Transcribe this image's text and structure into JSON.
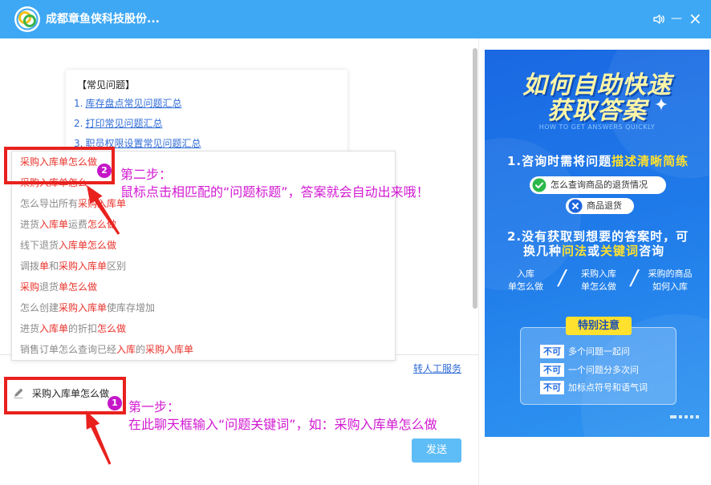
{
  "window": {
    "title": "成都章鱼侠科技股份...",
    "controls": {
      "minimize": "—",
      "close": "×"
    }
  },
  "icons": {
    "logo": "app-logo",
    "sound": "speaker-icon",
    "edit": "pencil-icon",
    "good_example": "check-circle-icon",
    "bad_example": "x-circle-icon",
    "title_decoration": "sparkle-icon"
  },
  "faq": {
    "heading": "【常见问题】",
    "items": [
      {
        "num": "1.",
        "text": "库存盘点常见问题汇总"
      },
      {
        "num": "2.",
        "text": "打印常见问题汇总"
      },
      {
        "num": "3.",
        "text": "职员权限设置常见问题汇总"
      }
    ]
  },
  "suggestions": [
    {
      "segments": [
        {
          "t": "采购入库单怎么做",
          "hl": true
        }
      ]
    },
    {
      "segments": [
        {
          "t": "采购入库单怎么",
          "hl": true
        }
      ]
    },
    {
      "segments": [
        {
          "t": "怎么导出所有",
          "hl": false
        },
        {
          "t": "采购入库单",
          "hl": true
        }
      ]
    },
    {
      "segments": [
        {
          "t": "进货",
          "hl": false
        },
        {
          "t": "入库单",
          "hl": true
        },
        {
          "t": "运费",
          "hl": false
        },
        {
          "t": "怎么做",
          "hl": true
        }
      ]
    },
    {
      "segments": [
        {
          "t": "线下退货",
          "hl": false
        },
        {
          "t": "入库单怎么做",
          "hl": true
        }
      ]
    },
    {
      "segments": [
        {
          "t": "调拨",
          "hl": false
        },
        {
          "t": "单",
          "hl": true
        },
        {
          "t": "和",
          "hl": false
        },
        {
          "t": "采购入库单",
          "hl": true
        },
        {
          "t": "区别",
          "hl": false
        }
      ]
    },
    {
      "segments": [
        {
          "t": "采购",
          "hl": true
        },
        {
          "t": "退货",
          "hl": false
        },
        {
          "t": "单怎么做",
          "hl": true
        }
      ]
    },
    {
      "segments": [
        {
          "t": "怎么创建",
          "hl": false
        },
        {
          "t": "采购入库单",
          "hl": true
        },
        {
          "t": "使库存增加",
          "hl": false
        }
      ]
    },
    {
      "segments": [
        {
          "t": "进货",
          "hl": false
        },
        {
          "t": "入库单",
          "hl": true
        },
        {
          "t": "的折扣",
          "hl": false
        },
        {
          "t": "怎么做",
          "hl": true
        }
      ]
    },
    {
      "segments": [
        {
          "t": "销售订单怎么查询已经",
          "hl": false
        },
        {
          "t": "入库",
          "hl": true
        },
        {
          "t": "的",
          "hl": false
        },
        {
          "t": "采购入库单",
          "hl": true
        }
      ]
    }
  ],
  "annotations": {
    "step2": {
      "badge": "2",
      "title": "第二步：",
      "text": "鼠标点击相匹配的“问题标题”，答案就会自动出来哦！"
    },
    "step1": {
      "badge": "1",
      "title": "第一步：",
      "text": "在此聊天框输入“问题关键词”，如：采购入库单怎么做"
    }
  },
  "chat": {
    "transfer_link": "转人工服务",
    "input_value": "采购入库单怎么做",
    "send_label": "发送"
  },
  "promo": {
    "title_line1": "如何自助快速",
    "title_line2": "获取答案",
    "subtitle": "HOW TO GET ANSWERS QUICKLY",
    "tip1": {
      "text": "1.咨询时需将问题",
      "highlight": "描述清晰简练"
    },
    "good_example": "怎么查询商品的退货情况",
    "bad_example": "商品退货",
    "tip2": {
      "line1": "2.没有获取到想要的答案时，可",
      "line2_a": "换几种",
      "line2_b": "问法",
      "line2_c": "或",
      "line2_d": "关键词",
      "line2_e": "咨询"
    },
    "examples": [
      {
        "line1": "入库",
        "line2": "单怎么做"
      },
      {
        "line1": "采购入库",
        "line2": "单怎么做"
      },
      {
        "line1": "采购的商品",
        "line2": "如何入库"
      }
    ],
    "separator": "/",
    "notice": {
      "title": "特别注意",
      "badge": "不可",
      "rows": [
        "多个问题一起问",
        "一个问题分多次问",
        "加标点符号和语气词"
      ]
    }
  },
  "colors": {
    "header_bg": "#3fa8f4",
    "link": "#2f6bd6",
    "keyword_highlight": "#e8322b",
    "annotation_red": "#e8211d",
    "annotation_text": "#d21ad2",
    "step_badge": "#c417c8",
    "send_button": "#5ebdf6",
    "promo_blue": "#1f7ae9",
    "promo_yellow": "#ffe12e"
  }
}
